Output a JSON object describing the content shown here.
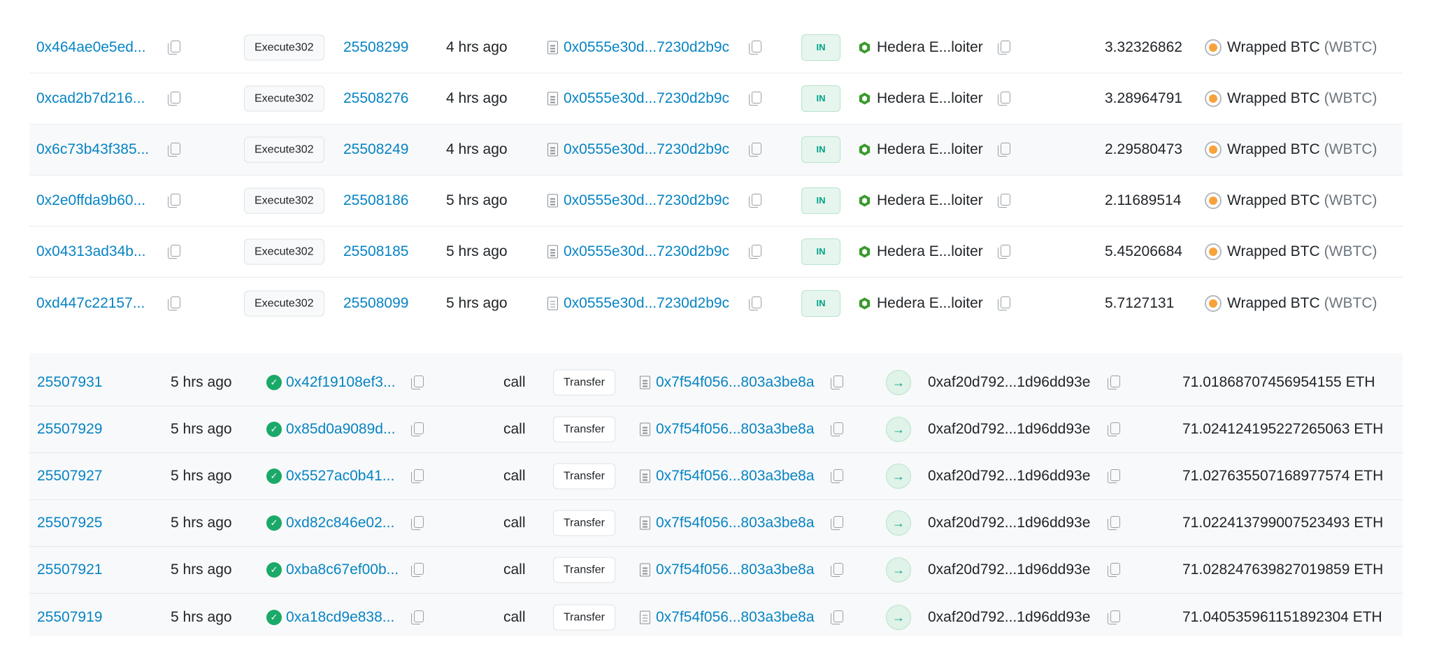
{
  "colors": {
    "link": "#0784c3",
    "in_badge": "#00a186",
    "success": "#1aa968",
    "btc": "#f7a23b",
    "hedera_icon": "#3a9a2e"
  },
  "token_transfers": {
    "rows": [
      {
        "txn_hash": "0x464ae0e5ed...",
        "method": "Execute302",
        "block": "25508299",
        "age": "4 hrs ago",
        "from": "0x0555e30d...7230d2b9c",
        "direction": "IN",
        "to": "Hedera E...loiter",
        "amount": "3.32326862",
        "token_name": "Wrapped BTC",
        "token_symbol": "(WBTC)"
      },
      {
        "txn_hash": "0xcad2b7d216...",
        "method": "Execute302",
        "block": "25508276",
        "age": "4 hrs ago",
        "from": "0x0555e30d...7230d2b9c",
        "direction": "IN",
        "to": "Hedera E...loiter",
        "amount": "3.28964791",
        "token_name": "Wrapped BTC",
        "token_symbol": "(WBTC)"
      },
      {
        "txn_hash": "0x6c73b43f385...",
        "method": "Execute302",
        "block": "25508249",
        "age": "4 hrs ago",
        "from": "0x0555e30d...7230d2b9c",
        "direction": "IN",
        "to": "Hedera E...loiter",
        "amount": "2.29580473",
        "token_name": "Wrapped BTC",
        "token_symbol": "(WBTC)"
      },
      {
        "txn_hash": "0x2e0ffda9b60...",
        "method": "Execute302",
        "block": "25508186",
        "age": "5 hrs ago",
        "from": "0x0555e30d...7230d2b9c",
        "direction": "IN",
        "to": "Hedera E...loiter",
        "amount": "2.11689514",
        "token_name": "Wrapped BTC",
        "token_symbol": "(WBTC)"
      },
      {
        "txn_hash": "0x04313ad34b...",
        "method": "Execute302",
        "block": "25508185",
        "age": "5 hrs ago",
        "from": "0x0555e30d...7230d2b9c",
        "direction": "IN",
        "to": "Hedera E...loiter",
        "amount": "5.45206684",
        "token_name": "Wrapped BTC",
        "token_symbol": "(WBTC)"
      },
      {
        "txn_hash": "0xd447c22157...",
        "method": "Execute302",
        "block": "25508099",
        "age": "5 hrs ago",
        "from": "0x0555e30d...7230d2b9c",
        "direction": "IN",
        "to": "Hedera E...loiter",
        "amount": "5.7127131",
        "token_name": "Wrapped BTC",
        "token_symbol": "(WBTC)"
      }
    ]
  },
  "internal_txns": {
    "rows": [
      {
        "block": "25507931",
        "age": "5 hrs ago",
        "parent_txn": "0x42f19108ef3...",
        "type": "call",
        "method": "Transfer",
        "from": "0x7f54f056...803a3be8a",
        "to": "0xaf20d792...1d96dd93e",
        "value": "71.01868707456954155 ETH"
      },
      {
        "block": "25507929",
        "age": "5 hrs ago",
        "parent_txn": "0x85d0a9089d...",
        "type": "call",
        "method": "Transfer",
        "from": "0x7f54f056...803a3be8a",
        "to": "0xaf20d792...1d96dd93e",
        "value": "71.024124195227265063 ETH"
      },
      {
        "block": "25507927",
        "age": "5 hrs ago",
        "parent_txn": "0x5527ac0b41...",
        "type": "call",
        "method": "Transfer",
        "from": "0x7f54f056...803a3be8a",
        "to": "0xaf20d792...1d96dd93e",
        "value": "71.027635507168977574 ETH"
      },
      {
        "block": "25507925",
        "age": "5 hrs ago",
        "parent_txn": "0xd82c846e02...",
        "type": "call",
        "method": "Transfer",
        "from": "0x7f54f056...803a3be8a",
        "to": "0xaf20d792...1d96dd93e",
        "value": "71.022413799007523493 ETH"
      },
      {
        "block": "25507921",
        "age": "5 hrs ago",
        "parent_txn": "0xba8c67ef00b...",
        "type": "call",
        "method": "Transfer",
        "from": "0x7f54f056...803a3be8a",
        "to": "0xaf20d792...1d96dd93e",
        "value": "71.028247639827019859 ETH"
      },
      {
        "block": "25507919",
        "age": "5 hrs ago",
        "parent_txn": "0xa18cd9e838...",
        "type": "call",
        "method": "Transfer",
        "from": "0x7f54f056...803a3be8a",
        "to": "0xaf20d792...1d96dd93e",
        "value": "71.040535961151892304 ETH"
      }
    ]
  }
}
